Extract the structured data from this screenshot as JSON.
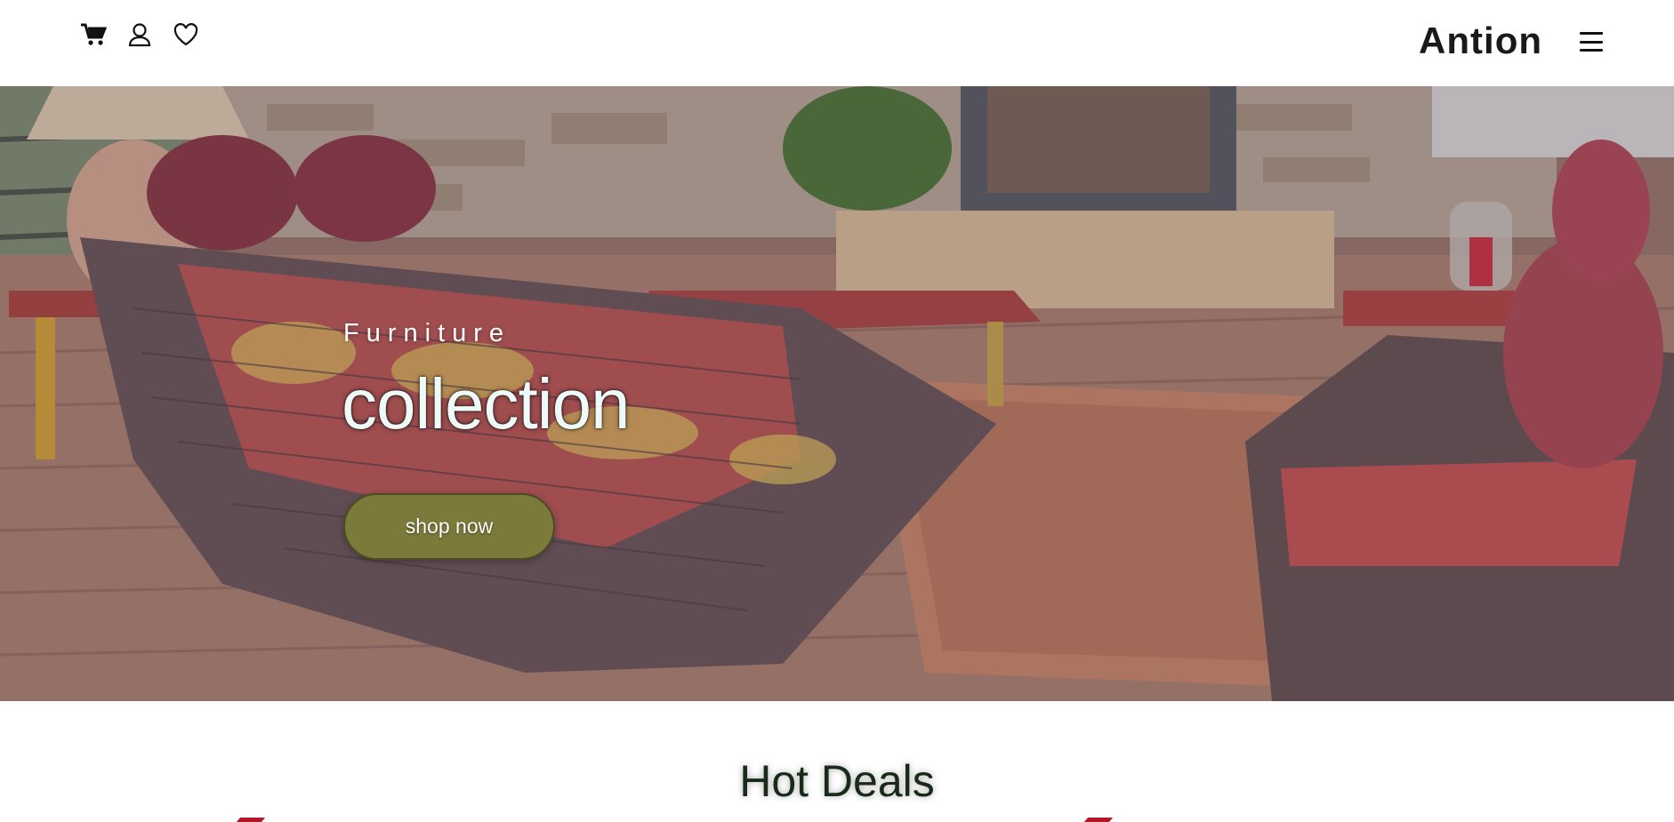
{
  "header": {
    "brand": "Antion",
    "icons": [
      "cart-icon",
      "user-icon",
      "heart-icon",
      "hamburger-menu-icon"
    ]
  },
  "hero": {
    "eyebrow": "Furniture",
    "title": "collection",
    "cta_label": "shop now",
    "cta_color": "#7c7a3a"
  },
  "deals": {
    "title": "Hot Deals"
  }
}
